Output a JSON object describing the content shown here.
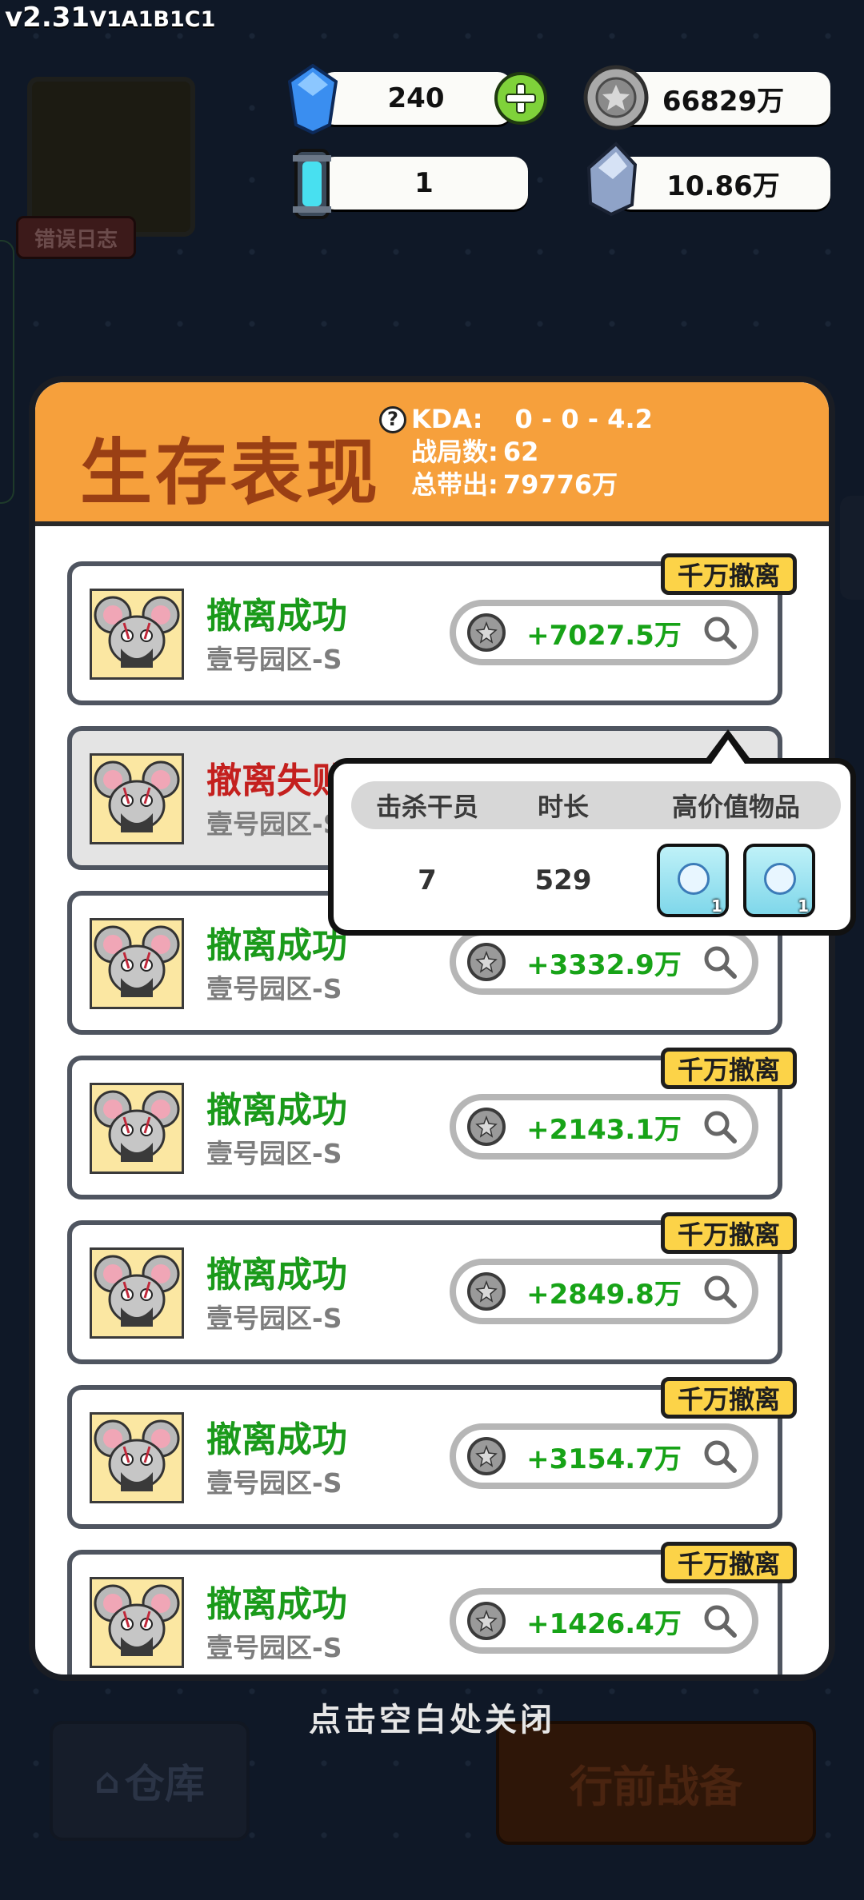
{
  "version": {
    "main": "v2.31",
    "sub": "V1A1B1C1"
  },
  "background": {
    "error_log_label": "错误日志",
    "warehouse_label": "仓库",
    "prepare_label": "行前战备"
  },
  "resources": {
    "diamond": "240",
    "coins": "66829万",
    "energy": "1",
    "crystal": "10.86万"
  },
  "dialog": {
    "title": "生存表现",
    "stats": {
      "kda_label": "KDA:",
      "kda_value": "0 - 0 - 4.2",
      "matches_label": "战局数:",
      "matches_value": "62",
      "total_label": "总带出:",
      "total_value": "79776万"
    },
    "records": [
      {
        "status": "撤离成功",
        "zone": "壹号园区-S",
        "value": "+7027.5万",
        "tag": "千万撤离"
      },
      {
        "status": "撤离失败",
        "zone": "壹号园区-S",
        "value": "",
        "tag": ""
      },
      {
        "status": "撤离成功",
        "zone": "壹号园区-S",
        "value": "+3332.9万",
        "tag": ""
      },
      {
        "status": "撤离成功",
        "zone": "壹号园区-S",
        "value": "+2143.1万",
        "tag": "千万撤离"
      },
      {
        "status": "撤离成功",
        "zone": "壹号园区-S",
        "value": "+2849.8万",
        "tag": "千万撤离"
      },
      {
        "status": "撤离成功",
        "zone": "壹号园区-S",
        "value": "+3154.7万",
        "tag": "千万撤离"
      },
      {
        "status": "撤离成功",
        "zone": "壹号园区-S",
        "value": "+1426.4万",
        "tag": "千万撤离"
      }
    ]
  },
  "popup": {
    "headers": [
      "击杀干员",
      "时长",
      "高价值物品"
    ],
    "kills": "7",
    "duration": "529",
    "items": [
      {
        "count": "1"
      },
      {
        "count": "1"
      }
    ]
  },
  "close_hint": "点击空白处关闭",
  "colors": {
    "success": "#1a9a1a",
    "fail": "#c4201e",
    "header": "#f6a03c",
    "tag": "#fcd348"
  }
}
